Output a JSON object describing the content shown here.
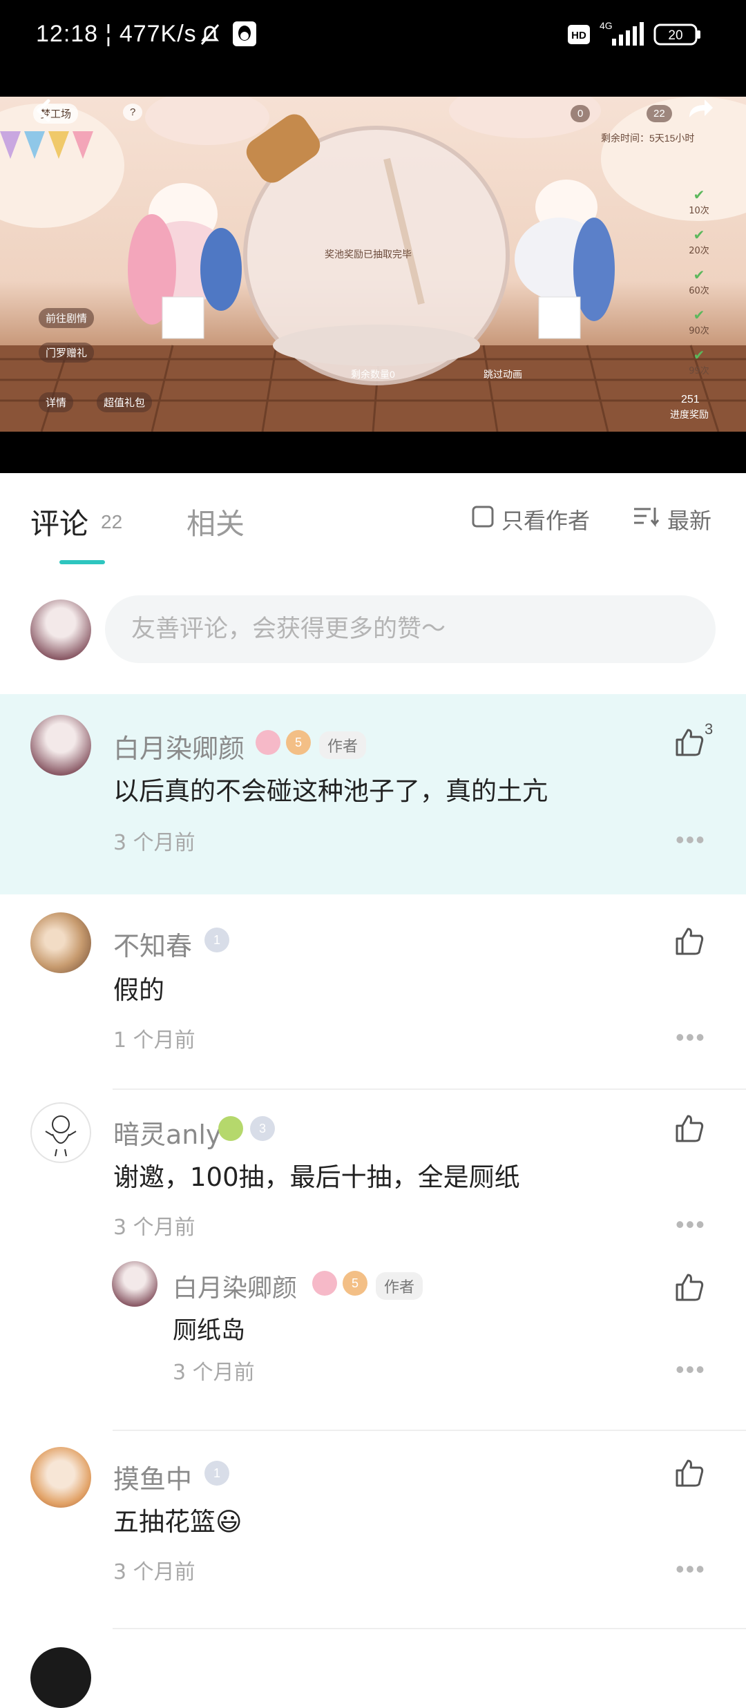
{
  "status_bar": {
    "time": "12:18",
    "speed": "477K/s",
    "hd": "HD",
    "network": "4G",
    "battery": "20"
  },
  "video": {
    "channel_label": "梦工场",
    "help": "?",
    "coin_a": "0",
    "coin_b": "22",
    "time_left": "剩余时间：5天15小时",
    "pool_status": "奖池奖励已抽取完毕",
    "remaining": "剩余数量0",
    "skip": "跳过动画",
    "btn_story": "前往剧情",
    "btn_gift": "门罗赠礼",
    "btn_detail": "详情",
    "btn_pack": "超值礼包",
    "progress_count": "251",
    "progress_label": "进度奖励",
    "milestones": [
      "10次",
      "20次",
      "60次",
      "90次",
      "99次"
    ]
  },
  "tabs": {
    "comments_label": "评论",
    "comments_count": "22",
    "related_label": "相关",
    "author_only": "只看作者",
    "sort": "最新"
  },
  "input": {
    "placeholder": "友善评论，会获得更多的赞～"
  },
  "comments": [
    {
      "name": "白月染卿颜",
      "author_tag": "作者",
      "level": "5",
      "text": "以后真的不会碰这种池子了，真的土亢",
      "time": "3 个月前",
      "likes": "3"
    },
    {
      "name": "不知春",
      "level": "1",
      "text": "假的",
      "time": "1 个月前"
    },
    {
      "name": "暗灵anly",
      "level": "3",
      "text": "谢邀，100抽，最后十抽，全是厕纸",
      "time": "3 个月前",
      "reply": {
        "name": "白月染卿颜",
        "author_tag": "作者",
        "level": "5",
        "text": "厕纸岛",
        "time": "3 个月前"
      }
    },
    {
      "name": "摸鱼中",
      "level": "1",
      "text": "五抽花篮😃",
      "time": "3 个月前"
    }
  ],
  "colors": {
    "accent": "#2ec5bf",
    "highlight_bg": "#e8f8f8"
  }
}
